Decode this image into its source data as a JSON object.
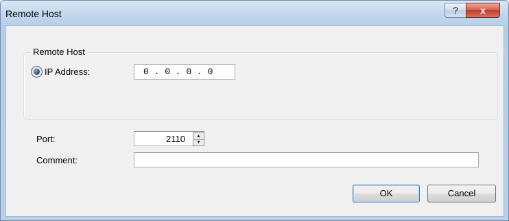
{
  "window": {
    "title": "Remote Host",
    "help_glyph": "?",
    "close_glyph": "x"
  },
  "group": {
    "label": "Remote Host",
    "radio_label": "IP Address:",
    "radio_selected": true,
    "ip_value": "0 . 0 . 0 . 0"
  },
  "port": {
    "label": "Port:",
    "value": "2110",
    "up_glyph": "▲",
    "down_glyph": "▼"
  },
  "comment": {
    "label": "Comment:",
    "value": ""
  },
  "buttons": {
    "ok_label": "OK",
    "cancel_label": "Cancel"
  },
  "colors": {
    "titlebar": "#c5d9ee",
    "close_button": "#c0392b",
    "client": "#f0f0f0",
    "default_button_border": "#3c7fb1"
  },
  "icons": {
    "help": "help-icon",
    "close": "close-icon",
    "radio": "radio-selected-icon",
    "spin_up": "spin-up-icon",
    "spin_down": "spin-down-icon"
  }
}
